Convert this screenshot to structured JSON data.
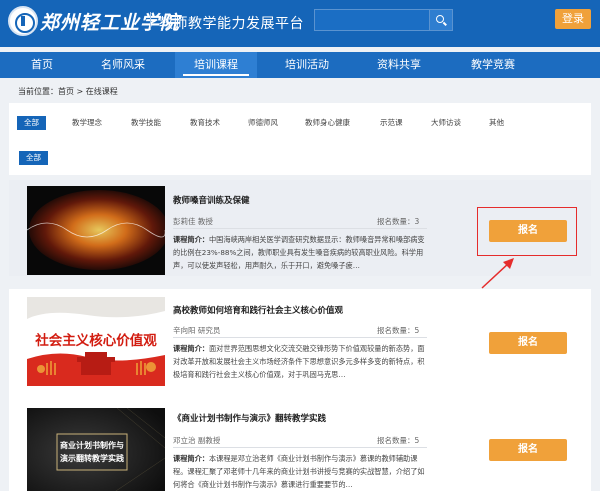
{
  "header": {
    "school_name": "郑州轻工业学院",
    "platform_title": "教师教学能力发展平台",
    "search": {
      "placeholder": "",
      "icon": "search-icon"
    },
    "login_label": "登录"
  },
  "nav": {
    "items": [
      {
        "label": "首页",
        "active": false
      },
      {
        "label": "名师风采",
        "active": false
      },
      {
        "label": "培训课程",
        "active": true
      },
      {
        "label": "培训活动",
        "active": false
      },
      {
        "label": "资料共享",
        "active": false
      },
      {
        "label": "教学竞赛",
        "active": false
      }
    ]
  },
  "breadcrumb": {
    "text": "当前位置：首页 > 在线课程"
  },
  "filters": {
    "categories": [
      "全部",
      "教学理念",
      "教学技能",
      "教育技术",
      "师德师风",
      "教师身心健康",
      "示范课",
      "大师访谈",
      "其他"
    ],
    "active_category": "全部",
    "sub_all_label": "全部"
  },
  "courses": [
    {
      "title": "教师嗓音训练及保健",
      "teacher": "彭莉佳 教授",
      "signup_count": "报名数量：3",
      "intro_label": "课程简介：",
      "intro": "中国海峡两岸相关医学调查研究数据显示：教师嗓音异常和嗓部病变的比例在23%-88%之间，教师职业具有发生嗓音疾病的较高职业风险。科学用声，可以使发声轻松，用声耐久，乐于开口，避免嗓子疲…",
      "button_label": "报名",
      "thumbnail": "audio-waveform-image"
    },
    {
      "title": "高校教师如何培育和践行社会主义核心价值观",
      "teacher": "辛向阳 研究员",
      "signup_count": "报名数量：5",
      "intro_label": "课程简介：",
      "intro": "面对世界范围思想文化交流交融交锋形势下价值观较量的新态势，面对改革开放和发展社会主义市场经济条件下思想意识多元多样多变的新特点，积极培育和践行社会主义核心价值观，对于巩固马克思…",
      "button_label": "报名",
      "thumbnail_text": "社会主义核心价值观"
    },
    {
      "title": "《商业计划书制作与演示》翻转教学实践",
      "teacher": "邓立治 副教授",
      "signup_count": "报名数量：5",
      "intro_label": "课程简介：",
      "intro": "本课程是邓立治老师《商业计划书制作与演示》慕课的教师辅助课程。课程汇聚了邓老师十几年来的商业计划书讲授与竞赛的实战智慧，介绍了如何将合《商业计划书制作与演示》慕课进行重要要节的…",
      "button_label": "报名",
      "thumbnail_text": [
        "商业计划书制作与",
        "演示翻转教学实践"
      ]
    }
  ],
  "colors": {
    "header_blue": "#1565b8",
    "nav_blue": "#1c6cc0",
    "accent_orange": "#f0a13a",
    "annotation_red": "#e52c2c"
  }
}
